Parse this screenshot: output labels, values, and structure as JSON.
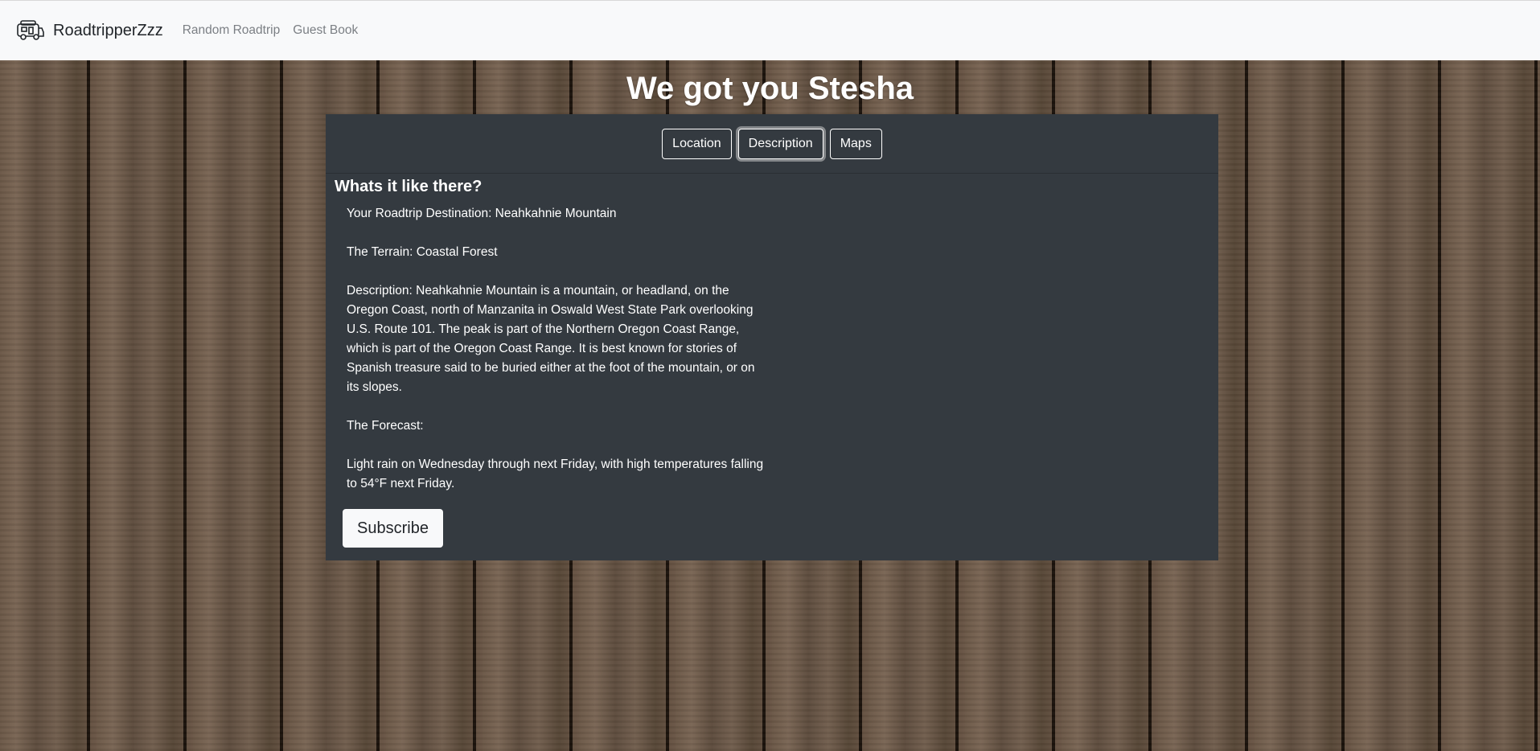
{
  "navbar": {
    "brand_icon": "rv-camper-icon",
    "brand": "RoadtripperZzz",
    "links": [
      "Random Roadtrip",
      "Guest Book"
    ]
  },
  "page": {
    "title": "We got you Stesha"
  },
  "tabs": [
    "Location",
    "Description",
    "Maps"
  ],
  "active_tab": "Description",
  "content": {
    "heading": "Whats it like there?",
    "destination": "Your Roadtrip Destination: Neahkahnie Mountain",
    "terrain": "The Terrain: Coastal Forest",
    "description": "Description: Neahkahnie Mountain is a mountain, or headland, on the Oregon Coast, north of Manzanita in Oswald West State Park overlooking U.S. Route 101. The peak is part of the Northern Oregon Coast Range, which is part of the Oregon Coast Range. It is best known for stories of Spanish treasure said to be buried either at the foot of the mountain, or on its slopes.",
    "forecast_label": "The Forecast:",
    "forecast": "Light rain on Wednesday through next Friday, with high temperatures falling to 54°F next Friday."
  },
  "subscribe_label": "Subscribe"
}
